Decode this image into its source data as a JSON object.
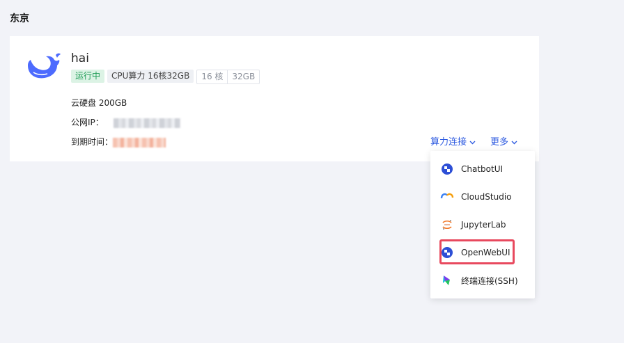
{
  "region_title": "东京",
  "instance": {
    "name": "hai",
    "status": "运行中",
    "spec": "CPU算力 16核32GB",
    "cores": "16 核",
    "memory": "32GB",
    "disk": "云硬盘 200GB",
    "ip_label": "公网IP：",
    "expire_label": "到期时间："
  },
  "actions": {
    "connect": "算力连接",
    "more": "更多"
  },
  "dropdown": {
    "items": [
      {
        "label": "ChatbotUI",
        "icon": "chatbotui-icon"
      },
      {
        "label": "CloudStudio",
        "icon": "cloudstudio-icon"
      },
      {
        "label": "JupyterLab",
        "icon": "jupyter-icon"
      },
      {
        "label": "OpenWebUI",
        "icon": "openwebui-icon"
      },
      {
        "label": "终端连接(SSH)",
        "icon": "terminal-icon"
      }
    ]
  },
  "colors": {
    "accent": "#2e5be0",
    "running": "#1e9c55",
    "highlight": "#e8495e",
    "logo": "#4d6bfe"
  }
}
